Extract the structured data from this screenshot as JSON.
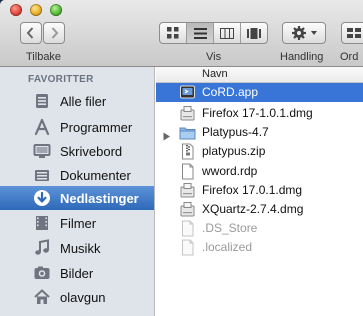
{
  "toolbar": {
    "back_label": "Tilbake",
    "view_label": "Vis",
    "action_label": "Handling",
    "arrange_label": "Ord"
  },
  "sidebar": {
    "heading": "FAVORITTER",
    "items": [
      {
        "label": "Alle filer",
        "icon": "all-files-icon"
      },
      {
        "label": "Programmer",
        "icon": "applications-icon"
      },
      {
        "label": "Skrivebord",
        "icon": "desktop-icon"
      },
      {
        "label": "Dokumenter",
        "icon": "documents-icon"
      },
      {
        "label": "Nedlastinger",
        "icon": "downloads-icon",
        "selected": true
      },
      {
        "label": "Filmer",
        "icon": "movies-icon"
      },
      {
        "label": "Musikk",
        "icon": "music-icon"
      },
      {
        "label": "Bilder",
        "icon": "pictures-icon"
      },
      {
        "label": "olavgun",
        "icon": "home-icon"
      }
    ]
  },
  "files": {
    "column_header": "Navn",
    "rows": [
      {
        "name": "CoRD.app",
        "kind": "app",
        "selected": true
      },
      {
        "name": "Firefox 17-1.0.1.dmg",
        "kind": "dmg"
      },
      {
        "name": "Platypus-4.7",
        "kind": "folder"
      },
      {
        "name": "platypus.zip",
        "kind": "zip"
      },
      {
        "name": "wword.rdp",
        "kind": "doc"
      },
      {
        "name": "Firefox 17.0.1.dmg",
        "kind": "dmg"
      },
      {
        "name": "XQuartz-2.7.4.dmg",
        "kind": "dmg"
      },
      {
        "name": ".DS_Store",
        "kind": "hidden"
      },
      {
        "name": ".localized",
        "kind": "hidden"
      }
    ]
  },
  "colors": {
    "selection": "#3875d7",
    "sidebar_selection": "#3d7bcd",
    "sidebar_bg": "#dfe4ea"
  }
}
